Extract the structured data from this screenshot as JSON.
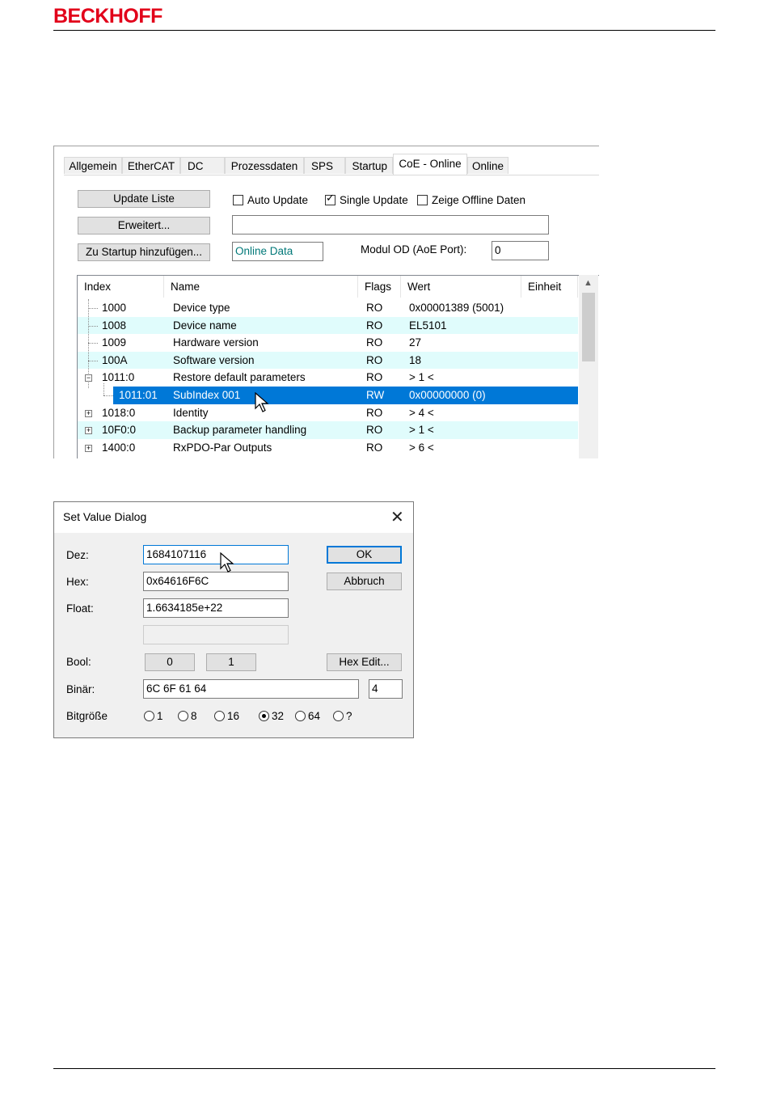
{
  "header": {
    "logo": "BECKHOFF",
    "brand_color": "#e2001a"
  },
  "tabs": [
    {
      "label": "Allgemein"
    },
    {
      "label": "EtherCAT"
    },
    {
      "label": "DC"
    },
    {
      "label": "Prozessdaten"
    },
    {
      "label": "SPS"
    },
    {
      "label": "Startup"
    },
    {
      "label": "CoE - Online",
      "active": true
    },
    {
      "label": "Online"
    }
  ],
  "controls": {
    "update_list": "Update Liste",
    "extended": "Erweitert...",
    "add_startup": "Zu Startup hinzufügen...",
    "auto_update": {
      "label": "Auto Update",
      "checked": false
    },
    "single_update": {
      "label": "Single Update",
      "checked": true
    },
    "offline_data": {
      "label": "Zeige Offline Daten",
      "checked": false
    },
    "filter_value": "",
    "online_data": "Online Data",
    "module_od_label": "Modul OD (AoE Port):",
    "module_od_value": "0"
  },
  "table": {
    "headers": [
      "Index",
      "Name",
      "Flags",
      "Wert",
      "Einheit"
    ],
    "rows": [
      {
        "index": "1000",
        "name": "Device type",
        "flags": "RO",
        "value": "0x00001389 (5001)",
        "style": "plain"
      },
      {
        "index": "1008",
        "name": "Device name",
        "flags": "RO",
        "value": "EL5101",
        "style": "alt"
      },
      {
        "index": "1009",
        "name": "Hardware version",
        "flags": "RO",
        "value": "27",
        "style": "plain"
      },
      {
        "index": "100A",
        "name": "Software version",
        "flags": "RO",
        "value": "18",
        "style": "alt"
      },
      {
        "index": "1011:0",
        "name": "Restore default parameters",
        "flags": "RO",
        "value": "> 1 <",
        "style": "plain",
        "expander": "minus"
      },
      {
        "index": "1011:01",
        "name": "SubIndex 001",
        "flags": "RW",
        "value": "0x00000000 (0)",
        "style": "sel"
      },
      {
        "index": "1018:0",
        "name": "Identity",
        "flags": "RO",
        "value": "> 4 <",
        "style": "plain",
        "expander": "plus"
      },
      {
        "index": "10F0:0",
        "name": "Backup parameter handling",
        "flags": "RO",
        "value": "> 1 <",
        "style": "alt",
        "expander": "plus"
      },
      {
        "index": "1400:0",
        "name": "RxPDO-Par Outputs",
        "flags": "RO",
        "value": "> 6 <",
        "style": "plain",
        "expander": "plus"
      }
    ]
  },
  "dialog": {
    "title": "Set Value Dialog",
    "close_icon": "close-icon",
    "dez_label": "Dez:",
    "dez_value": "1684107116",
    "hex_label": "Hex:",
    "hex_value": "0x64616F6C",
    "float_label": "Float:",
    "float_value": "1.6634185e+22",
    "extra_value": "",
    "bool_label": "Bool:",
    "bool_0": "0",
    "bool_1": "1",
    "binary_label": "Binär:",
    "binary_value": "6C 6F 61 64",
    "binary_len": "4",
    "bitsize_label": "Bitgröße",
    "ok": "OK",
    "cancel": "Abbruch",
    "hex_edit": "Hex Edit...",
    "bitsizes": [
      {
        "label": "1",
        "selected": false
      },
      {
        "label": "8",
        "selected": false
      },
      {
        "label": "16",
        "selected": false
      },
      {
        "label": "32",
        "selected": true
      },
      {
        "label": "64",
        "selected": false
      },
      {
        "label": "?",
        "selected": false
      }
    ]
  }
}
